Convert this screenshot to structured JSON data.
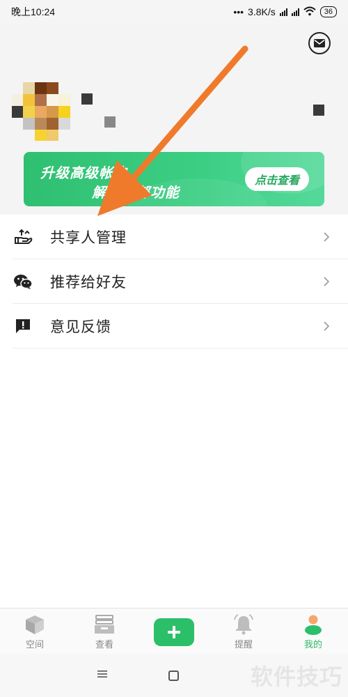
{
  "status_bar": {
    "time": "晚上10:24",
    "network_speed": "3.8K/s",
    "battery": "36"
  },
  "header": {
    "mail_icon": "mail-icon"
  },
  "banner": {
    "line1": "升级高级帐户",
    "line2": "解锁全部功能",
    "button_label": "点击查看"
  },
  "menu": {
    "items": [
      {
        "label": "共享人管理",
        "icon": "share-hand-icon"
      },
      {
        "label": "推荐给好友",
        "icon": "wechat-icon"
      },
      {
        "label": "意见反馈",
        "icon": "feedback-icon"
      }
    ]
  },
  "bottom_nav": {
    "items": [
      {
        "label": "空间",
        "icon": "cube-icon"
      },
      {
        "label": "查看",
        "icon": "inbox-icon"
      },
      {
        "label": "",
        "icon": "plus-icon"
      },
      {
        "label": "提醒",
        "icon": "bell-icon"
      },
      {
        "label": "我的",
        "icon": "person-icon",
        "active": true
      }
    ]
  },
  "watermark": "软件技巧",
  "colors": {
    "accent": "#2bbf6a",
    "arrow": "#f07a2b"
  }
}
